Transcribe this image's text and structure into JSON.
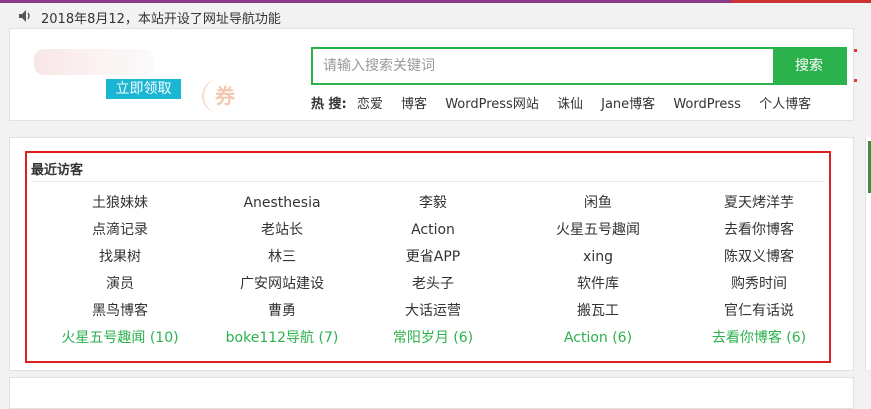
{
  "notice": {
    "text": "2018年8月12，本站开设了网址导航功能"
  },
  "header": {
    "claim_button": "立即领取",
    "coupon_mark": "券"
  },
  "search": {
    "placeholder": "请输入搜索关键词",
    "button": "搜索"
  },
  "hot": {
    "label": "热 搜:",
    "items": [
      "恋爱",
      "博客",
      "WordPress网站",
      "诛仙",
      "Jane博客",
      "WordPress",
      "个人博客"
    ]
  },
  "visitors": {
    "title": "最近访客",
    "rows": [
      [
        "土狼妹妹",
        "Anesthesia",
        "李毅",
        "闲鱼",
        "夏天烤洋芋"
      ],
      [
        "点滴记录",
        "老站长",
        "Action",
        "火星五号趣闻",
        "去看你博客"
      ],
      [
        "找果树",
        "林三",
        "更省APP",
        "xing",
        "陈双义博客"
      ],
      [
        "演员",
        "广安网站建设",
        "老头子",
        "软件库",
        "购秀时间"
      ],
      [
        "黑鸟博客",
        "曹勇",
        "大话运营",
        "搬瓦工",
        "官仁有话说"
      ]
    ],
    "top": [
      "火星五号趣闻 (10)",
      "boke112导航 (7)",
      "常阳岁月 (6)",
      "Action (6)",
      "去看你博客 (6)"
    ]
  },
  "colors": {
    "accent_green": "#2bb24c",
    "claim_blue": "#1bb6d4",
    "box_red": "#e02020"
  }
}
